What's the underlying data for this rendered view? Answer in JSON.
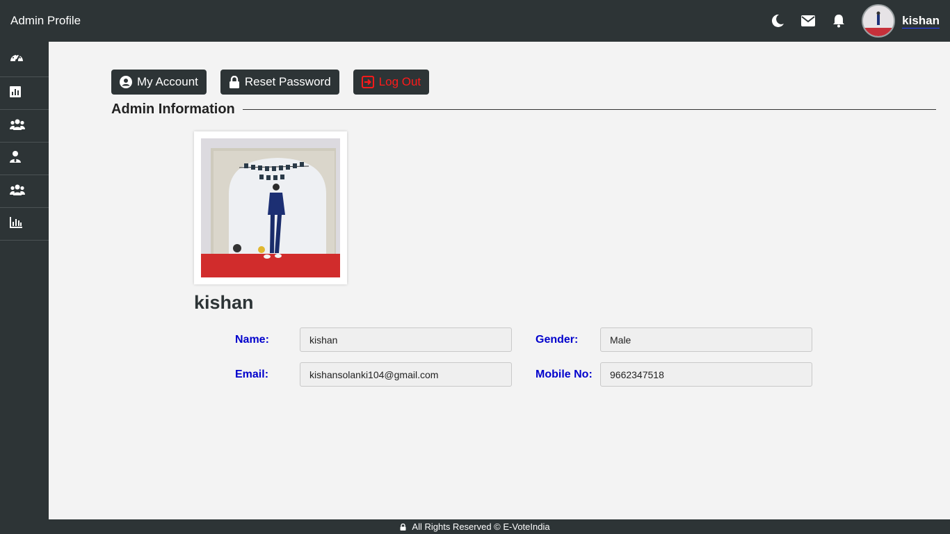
{
  "header": {
    "title": "Admin Profile",
    "icons": [
      "moon-icon",
      "envelope-icon",
      "bell-icon"
    ],
    "username": "kishan"
  },
  "sidebar": {
    "icons": [
      "dashboard-icon",
      "report-icon",
      "users-icon",
      "user-tie-icon",
      "users-icon",
      "bar-chart-icon"
    ]
  },
  "actions": {
    "my_account": "My Account",
    "reset_password": "Reset Password",
    "logout": "Log Out"
  },
  "section": {
    "title": "Admin Information"
  },
  "profile": {
    "display_name": "kishan",
    "fields": {
      "name_label": "Name:",
      "name_value": "kishan",
      "gender_label": "Gender:",
      "gender_value": "Male",
      "email_label": "Email:",
      "email_value": "kishansolanki104@gmail.com",
      "mobile_label": "Mobile No:",
      "mobile_value": "9662347518"
    }
  },
  "footer": {
    "text": "All Rights Reserved © E-VoteIndia"
  },
  "colors": {
    "dark": "#2d3436",
    "background": "#f3f3f3",
    "label_blue": "#0000cc",
    "logout_red": "#ff1a1a"
  }
}
